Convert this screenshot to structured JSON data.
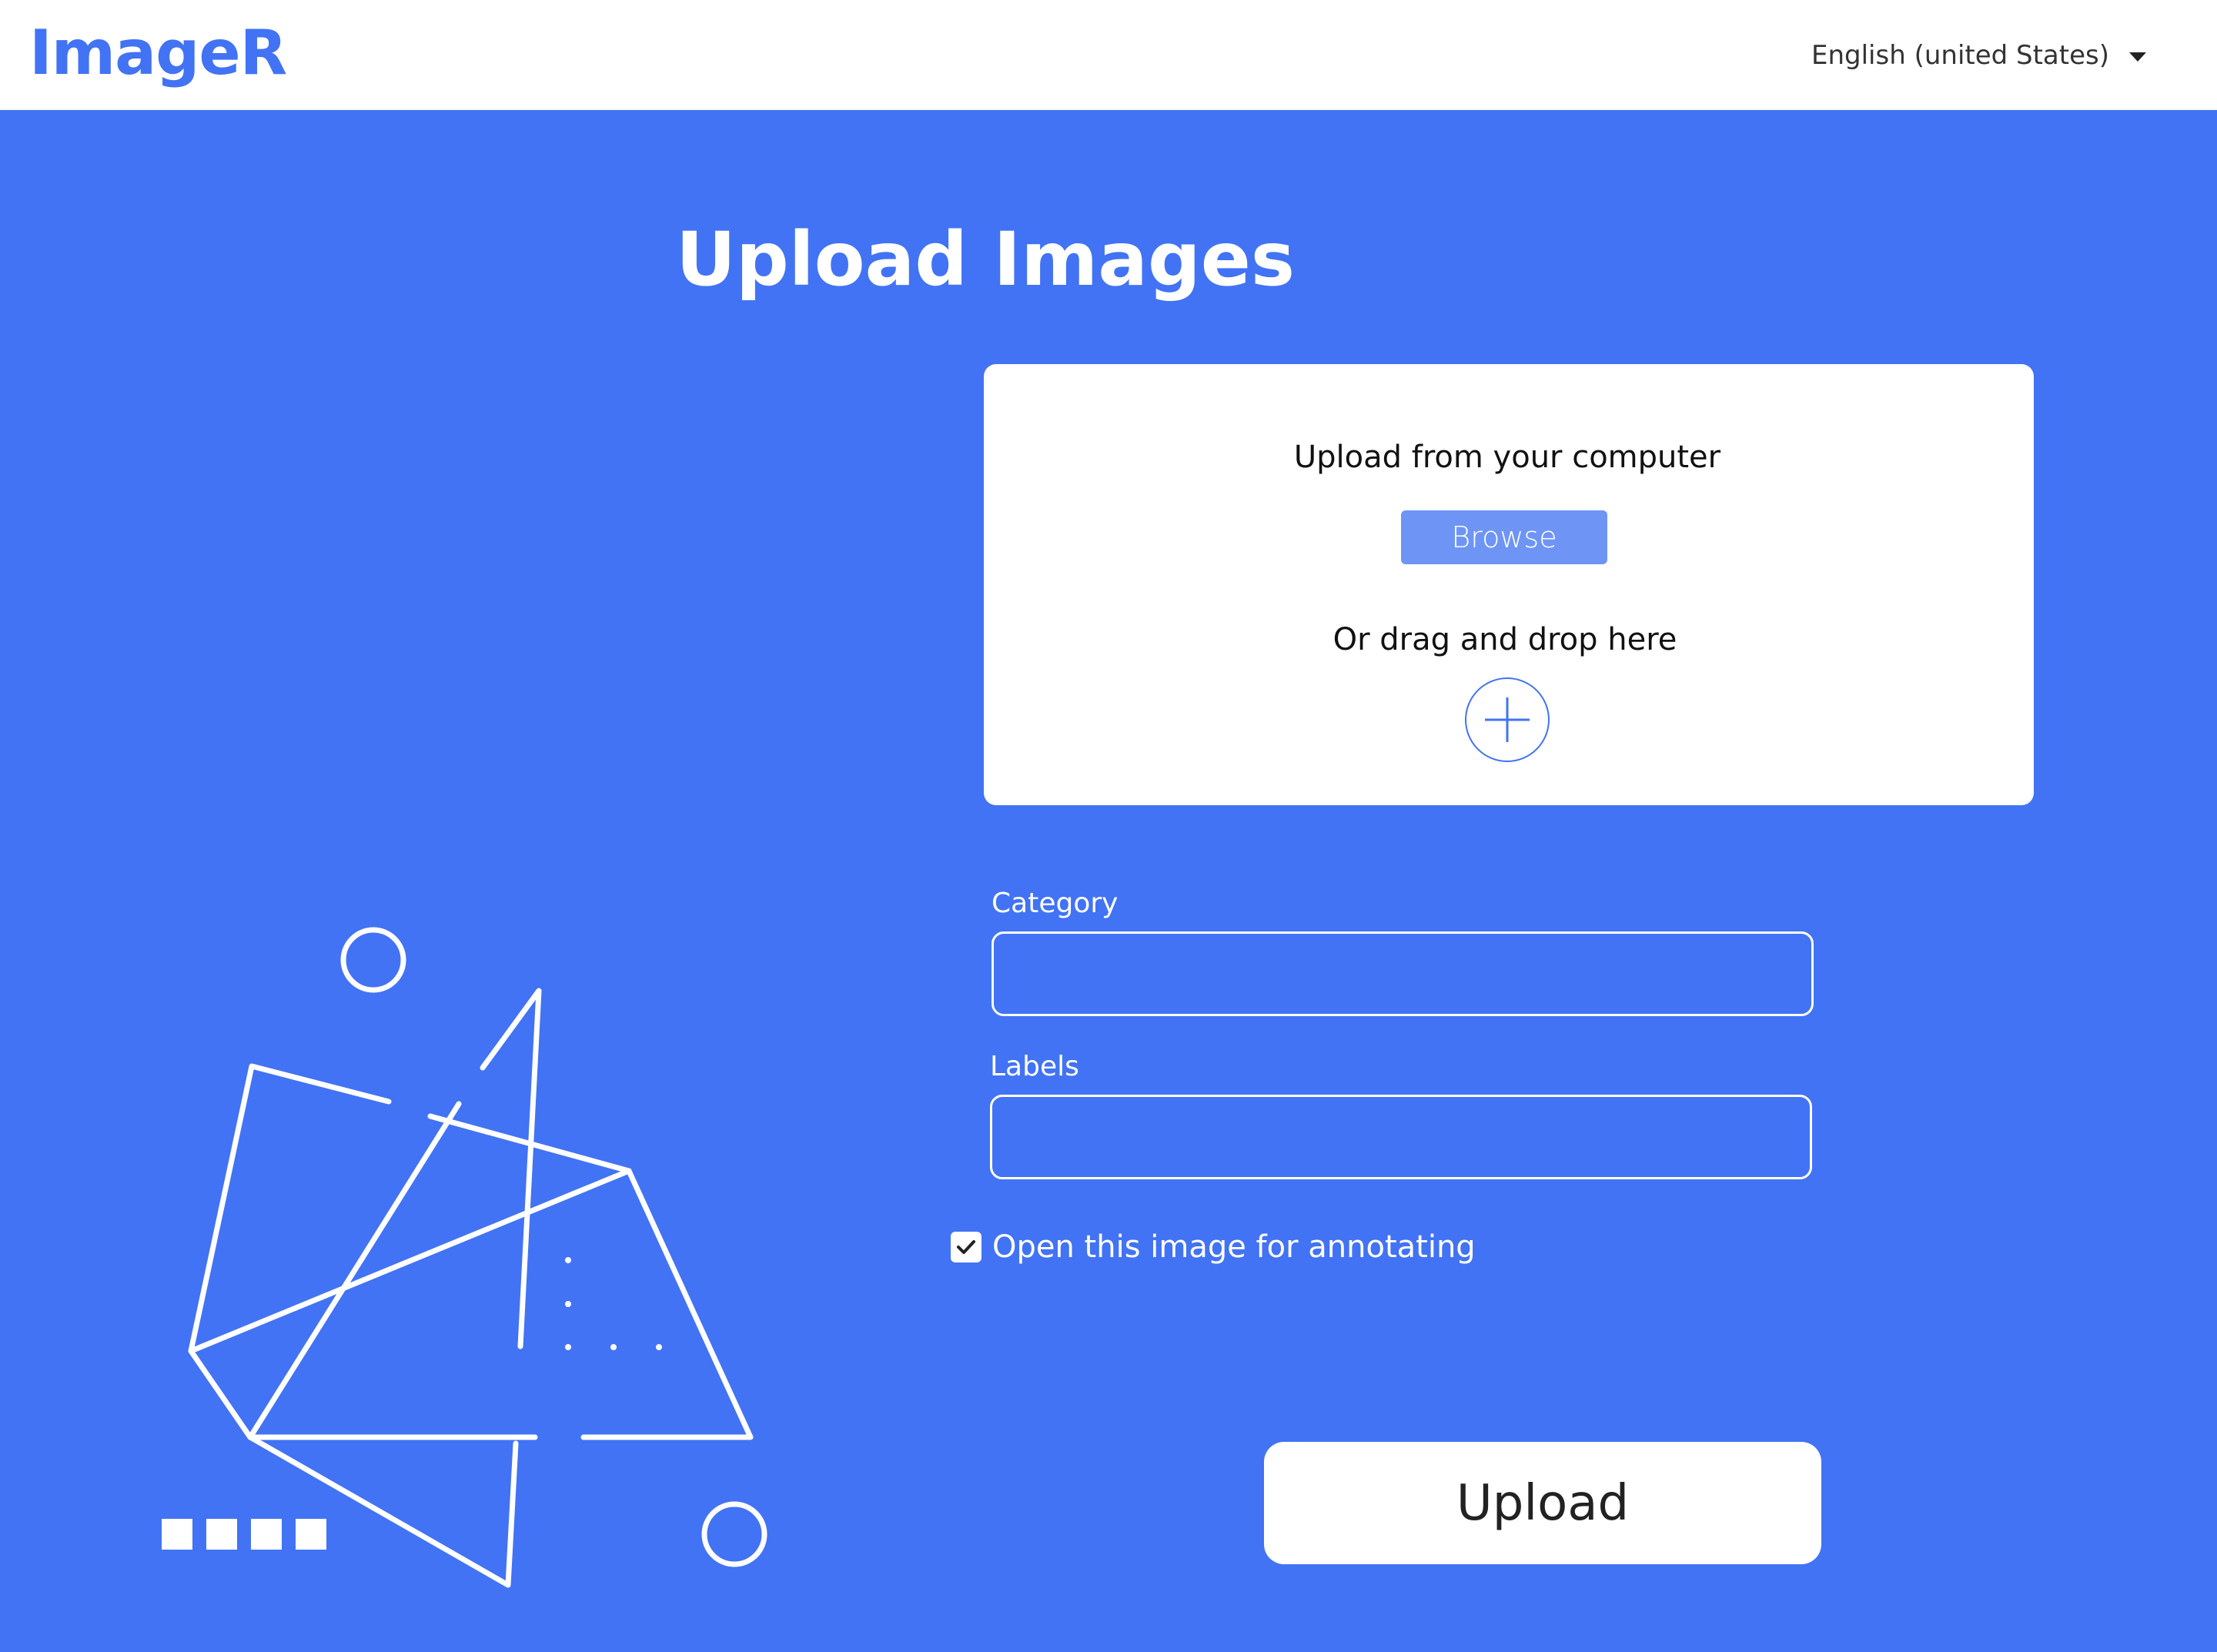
{
  "header": {
    "logo": "ImageR",
    "language": "English (united States)"
  },
  "main": {
    "title": "Upload Images",
    "upload_card": {
      "from_computer": "Upload from your computer",
      "browse_label": "Browse",
      "drag_drop": "Or drag and drop here",
      "add_icon": "plus-circle-icon"
    },
    "category": {
      "label": "Category",
      "value": ""
    },
    "labels": {
      "label": "Labels",
      "value": ""
    },
    "annotate": {
      "label": "Open this image for annotating",
      "checked": true
    },
    "upload_label": "Upload"
  },
  "colors": {
    "brand": "#4273f4",
    "browse": "#6e95f5",
    "white": "#ffffff"
  }
}
